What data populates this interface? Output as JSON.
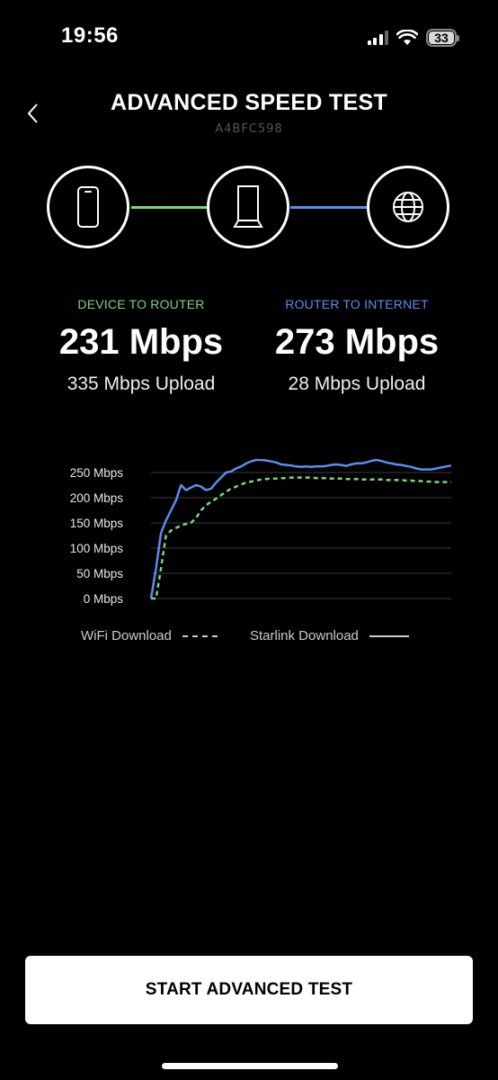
{
  "status_bar": {
    "time": "19:56",
    "battery": "33"
  },
  "header": {
    "title": "ADVANCED SPEED TEST",
    "serial": "A4BFC598"
  },
  "topology": {
    "nodes": [
      "phone-icon",
      "router-icon",
      "globe-icon"
    ],
    "link_colors": [
      "#7fd47e",
      "#5b8def"
    ]
  },
  "stats": {
    "device_to_router": {
      "label": "DEVICE TO ROUTER",
      "value": "231 Mbps",
      "upload": "335 Mbps Upload",
      "color": "#7fd47e"
    },
    "router_to_internet": {
      "label": "ROUTER TO INTERNET",
      "value": "273 Mbps",
      "upload": "28 Mbps Upload",
      "color": "#5b8def"
    }
  },
  "chart_data": {
    "type": "line",
    "title": "",
    "xlabel": "",
    "ylabel": "",
    "ylim": [
      0,
      250
    ],
    "yticks": [
      "250 Mbps",
      "200 Mbps",
      "150 Mbps",
      "100 Mbps",
      "50 Mbps",
      "0 Mbps"
    ],
    "grid": true,
    "legend_position": "bottom",
    "series": [
      {
        "name": "WiFi Download",
        "style": "dashed",
        "color": "#7fd47e",
        "values": [
          0,
          0,
          60,
          125,
          135,
          140,
          145,
          148,
          150,
          160,
          175,
          185,
          192,
          198,
          205,
          212,
          218,
          222,
          226,
          230,
          232,
          234,
          236,
          237,
          238,
          238,
          239,
          239,
          240,
          240,
          240,
          240,
          240,
          239,
          239,
          239,
          238,
          238,
          238,
          237,
          237,
          237,
          236,
          236,
          236,
          236,
          236,
          235,
          235,
          235,
          235,
          234,
          234,
          233,
          233,
          232,
          232,
          231,
          231,
          231,
          231
        ]
      },
      {
        "name": "Starlink Download",
        "style": "solid",
        "color": "#5b8def",
        "values": [
          0,
          60,
          130,
          155,
          175,
          195,
          225,
          215,
          220,
          225,
          222,
          215,
          218,
          230,
          240,
          250,
          252,
          258,
          262,
          268,
          272,
          275,
          275,
          274,
          272,
          270,
          266,
          265,
          264,
          262,
          261,
          262,
          261,
          262,
          262,
          263,
          265,
          266,
          265,
          263,
          266,
          268,
          268,
          270,
          273,
          275,
          273,
          270,
          268,
          266,
          265,
          263,
          261,
          258,
          256,
          256,
          256,
          258,
          260,
          262,
          264
        ]
      }
    ]
  },
  "button": {
    "label": "START ADVANCED TEST"
  }
}
